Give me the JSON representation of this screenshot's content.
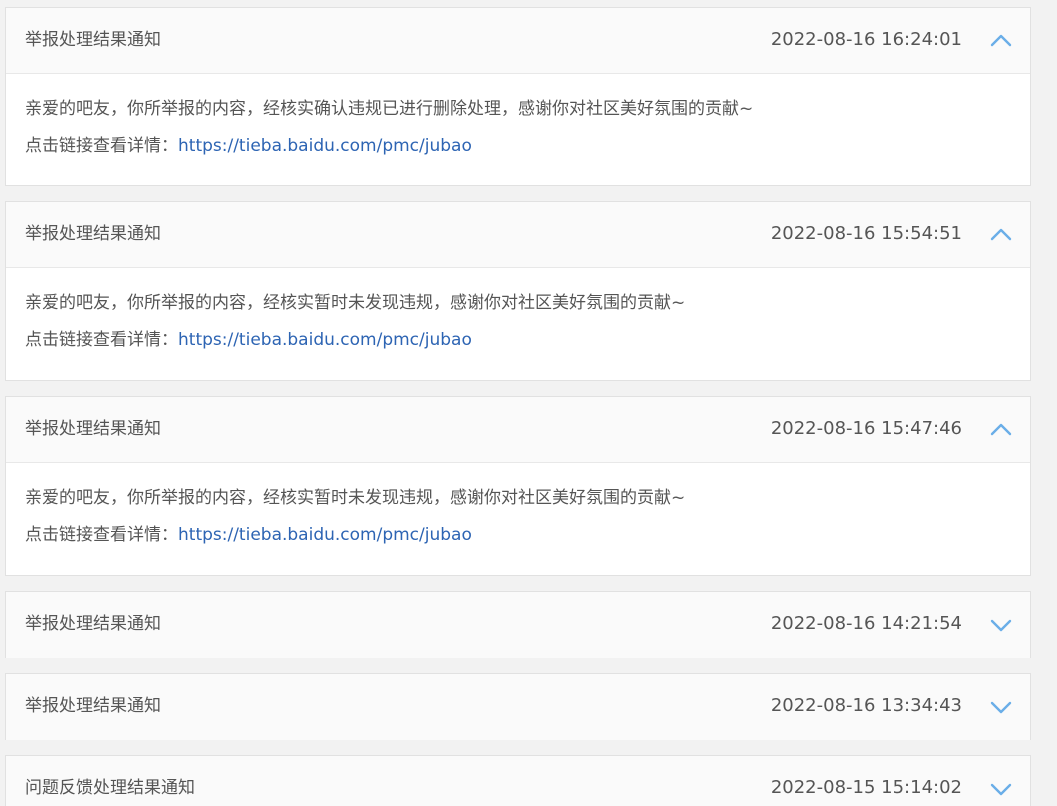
{
  "notifications": [
    {
      "title": "举报处理结果通知",
      "time": "2022-08-16 16:24:01",
      "expanded": true,
      "message": "亲爱的吧友，你所举报的内容，经核实确认违规已进行删除处理，感谢你对社区美好氛围的贡献~",
      "link_prefix": "点击链接查看详情：",
      "link_url": "https://tieba.baidu.com/pmc/jubao",
      "toggle_icon": "chevron-up-icon"
    },
    {
      "title": "举报处理结果通知",
      "time": "2022-08-16 15:54:51",
      "expanded": true,
      "message": "亲爱的吧友，你所举报的内容，经核实暂时未发现违规，感谢你对社区美好氛围的贡献~",
      "link_prefix": "点击链接查看详情：",
      "link_url": "https://tieba.baidu.com/pmc/jubao",
      "toggle_icon": "chevron-up-icon"
    },
    {
      "title": "举报处理结果通知",
      "time": "2022-08-16 15:47:46",
      "expanded": true,
      "message": "亲爱的吧友，你所举报的内容，经核实暂时未发现违规，感谢你对社区美好氛围的贡献~",
      "link_prefix": "点击链接查看详情：",
      "link_url": "https://tieba.baidu.com/pmc/jubao",
      "toggle_icon": "chevron-up-icon"
    },
    {
      "title": "举报处理结果通知",
      "time": "2022-08-16 14:21:54",
      "expanded": false,
      "toggle_icon": "chevron-down-icon"
    },
    {
      "title": "举报处理结果通知",
      "time": "2022-08-16 13:34:43",
      "expanded": false,
      "toggle_icon": "chevron-down-icon"
    },
    {
      "title": "问题反馈处理结果通知",
      "time": "2022-08-15 15:14:02",
      "expanded": false,
      "toggle_icon": "chevron-down-icon"
    }
  ],
  "colors": {
    "page_background": "#f2f2f2",
    "card_header": "#fafafa",
    "text": "#555555",
    "link": "#2d64b3",
    "chevron": "#6aaee8"
  }
}
